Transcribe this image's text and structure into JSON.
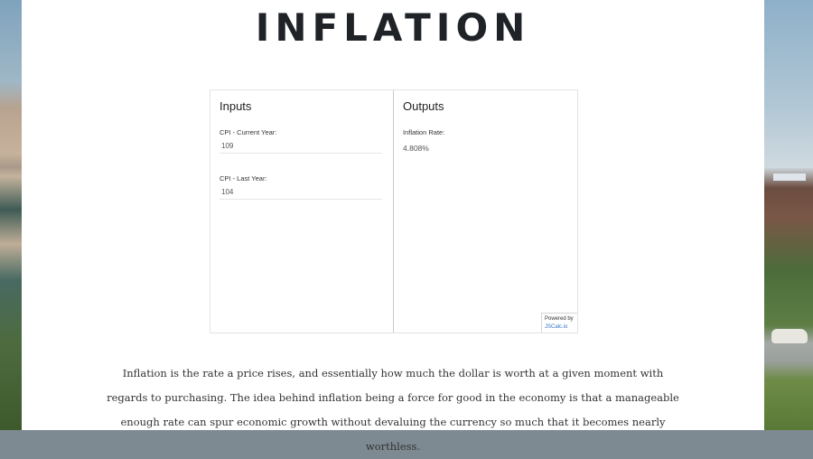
{
  "page": {
    "title": "INFLATION"
  },
  "calculator": {
    "inputs_heading": "Inputs",
    "outputs_heading": "Outputs",
    "fields": [
      {
        "label": "CPI - Current Year:",
        "value": "109"
      },
      {
        "label": "CPI - Last Year:",
        "value": "104"
      }
    ],
    "output": {
      "label": "Inflation Rate:",
      "value": "4.808%"
    },
    "powered_by": {
      "text": "Powered by",
      "link_text": "JSCalc.io"
    }
  },
  "article": {
    "paragraph": "Inflation is the rate a price rises, and essentially how much the dollar is worth at a given moment with regards to purchasing. The idea behind inflation being a force for good in the economy is that a manageable enough rate can spur economic growth without devaluing the currency so much that it becomes nearly worthless."
  }
}
